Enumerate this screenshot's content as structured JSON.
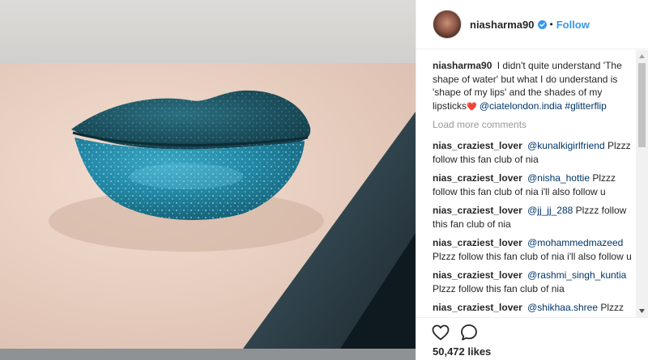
{
  "header": {
    "username": "niasharma90",
    "separator": "•",
    "follow_label": "Follow"
  },
  "caption": {
    "user": "niasharma90",
    "text": "I didn't quite understand 'The shape of water' but what I do understand is 'shape of my lips' and the shades of my lipsticks",
    "emoji": "❤️",
    "mention": "@ciatelondon.india",
    "hashtag": "#glitterflip"
  },
  "load_more": "Load more comments",
  "comments": [
    {
      "user": "nias_craziest_lover",
      "mention": "@kunalkigirlfriend",
      "text": "Plzzz follow this fan club of nia"
    },
    {
      "user": "nias_craziest_lover",
      "mention": "@nisha_hottie",
      "text": "Plzzz follow this fan club of nia i'll also follow u"
    },
    {
      "user": "nias_craziest_lover",
      "mention": "@jj_jj_288",
      "text": "Plzzz follow this fan club of nia"
    },
    {
      "user": "nias_craziest_lover",
      "mention": "@mohammedmazeed",
      "text": "Plzzz follow this fan club of nia i'll also follow u"
    },
    {
      "user": "nias_craziest_lover",
      "mention": "@rashmi_singh_kuntia",
      "text": "Plzzz follow this fan club of nia"
    },
    {
      "user": "nias_craziest_lover",
      "mention": "@shikhaa.shree",
      "text": "Plzzz follow this fan club of nia"
    }
  ],
  "likes": "50,472 likes",
  "icons": {
    "like": "heart-icon",
    "comment": "comment-icon",
    "verified": "verified-badge-icon"
  },
  "colors": {
    "link": "#3897f0",
    "mention": "#003569",
    "lip": "#1f6f86"
  }
}
